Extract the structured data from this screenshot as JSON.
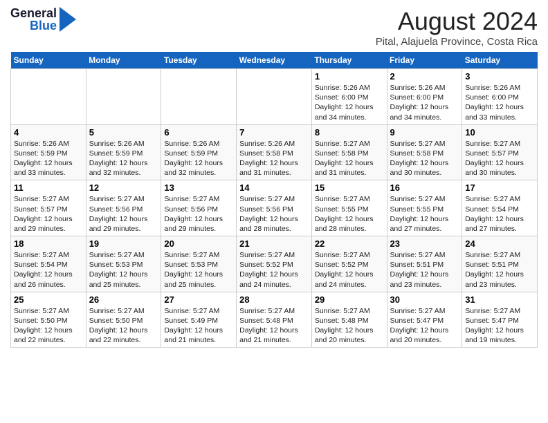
{
  "header": {
    "logo_general": "General",
    "logo_blue": "Blue",
    "title": "August 2024",
    "subtitle": "Pital, Alajuela Province, Costa Rica"
  },
  "weekdays": [
    "Sunday",
    "Monday",
    "Tuesday",
    "Wednesday",
    "Thursday",
    "Friday",
    "Saturday"
  ],
  "weeks": [
    [
      {
        "day": "",
        "info": ""
      },
      {
        "day": "",
        "info": ""
      },
      {
        "day": "",
        "info": ""
      },
      {
        "day": "",
        "info": ""
      },
      {
        "day": "1",
        "info": "Sunrise: 5:26 AM\nSunset: 6:00 PM\nDaylight: 12 hours\nand 34 minutes."
      },
      {
        "day": "2",
        "info": "Sunrise: 5:26 AM\nSunset: 6:00 PM\nDaylight: 12 hours\nand 34 minutes."
      },
      {
        "day": "3",
        "info": "Sunrise: 5:26 AM\nSunset: 6:00 PM\nDaylight: 12 hours\nand 33 minutes."
      }
    ],
    [
      {
        "day": "4",
        "info": "Sunrise: 5:26 AM\nSunset: 5:59 PM\nDaylight: 12 hours\nand 33 minutes."
      },
      {
        "day": "5",
        "info": "Sunrise: 5:26 AM\nSunset: 5:59 PM\nDaylight: 12 hours\nand 32 minutes."
      },
      {
        "day": "6",
        "info": "Sunrise: 5:26 AM\nSunset: 5:59 PM\nDaylight: 12 hours\nand 32 minutes."
      },
      {
        "day": "7",
        "info": "Sunrise: 5:26 AM\nSunset: 5:58 PM\nDaylight: 12 hours\nand 31 minutes."
      },
      {
        "day": "8",
        "info": "Sunrise: 5:27 AM\nSunset: 5:58 PM\nDaylight: 12 hours\nand 31 minutes."
      },
      {
        "day": "9",
        "info": "Sunrise: 5:27 AM\nSunset: 5:58 PM\nDaylight: 12 hours\nand 30 minutes."
      },
      {
        "day": "10",
        "info": "Sunrise: 5:27 AM\nSunset: 5:57 PM\nDaylight: 12 hours\nand 30 minutes."
      }
    ],
    [
      {
        "day": "11",
        "info": "Sunrise: 5:27 AM\nSunset: 5:57 PM\nDaylight: 12 hours\nand 29 minutes."
      },
      {
        "day": "12",
        "info": "Sunrise: 5:27 AM\nSunset: 5:56 PM\nDaylight: 12 hours\nand 29 minutes."
      },
      {
        "day": "13",
        "info": "Sunrise: 5:27 AM\nSunset: 5:56 PM\nDaylight: 12 hours\nand 29 minutes."
      },
      {
        "day": "14",
        "info": "Sunrise: 5:27 AM\nSunset: 5:56 PM\nDaylight: 12 hours\nand 28 minutes."
      },
      {
        "day": "15",
        "info": "Sunrise: 5:27 AM\nSunset: 5:55 PM\nDaylight: 12 hours\nand 28 minutes."
      },
      {
        "day": "16",
        "info": "Sunrise: 5:27 AM\nSunset: 5:55 PM\nDaylight: 12 hours\nand 27 minutes."
      },
      {
        "day": "17",
        "info": "Sunrise: 5:27 AM\nSunset: 5:54 PM\nDaylight: 12 hours\nand 27 minutes."
      }
    ],
    [
      {
        "day": "18",
        "info": "Sunrise: 5:27 AM\nSunset: 5:54 PM\nDaylight: 12 hours\nand 26 minutes."
      },
      {
        "day": "19",
        "info": "Sunrise: 5:27 AM\nSunset: 5:53 PM\nDaylight: 12 hours\nand 25 minutes."
      },
      {
        "day": "20",
        "info": "Sunrise: 5:27 AM\nSunset: 5:53 PM\nDaylight: 12 hours\nand 25 minutes."
      },
      {
        "day": "21",
        "info": "Sunrise: 5:27 AM\nSunset: 5:52 PM\nDaylight: 12 hours\nand 24 minutes."
      },
      {
        "day": "22",
        "info": "Sunrise: 5:27 AM\nSunset: 5:52 PM\nDaylight: 12 hours\nand 24 minutes."
      },
      {
        "day": "23",
        "info": "Sunrise: 5:27 AM\nSunset: 5:51 PM\nDaylight: 12 hours\nand 23 minutes."
      },
      {
        "day": "24",
        "info": "Sunrise: 5:27 AM\nSunset: 5:51 PM\nDaylight: 12 hours\nand 23 minutes."
      }
    ],
    [
      {
        "day": "25",
        "info": "Sunrise: 5:27 AM\nSunset: 5:50 PM\nDaylight: 12 hours\nand 22 minutes."
      },
      {
        "day": "26",
        "info": "Sunrise: 5:27 AM\nSunset: 5:50 PM\nDaylight: 12 hours\nand 22 minutes."
      },
      {
        "day": "27",
        "info": "Sunrise: 5:27 AM\nSunset: 5:49 PM\nDaylight: 12 hours\nand 21 minutes."
      },
      {
        "day": "28",
        "info": "Sunrise: 5:27 AM\nSunset: 5:48 PM\nDaylight: 12 hours\nand 21 minutes."
      },
      {
        "day": "29",
        "info": "Sunrise: 5:27 AM\nSunset: 5:48 PM\nDaylight: 12 hours\nand 20 minutes."
      },
      {
        "day": "30",
        "info": "Sunrise: 5:27 AM\nSunset: 5:47 PM\nDaylight: 12 hours\nand 20 minutes."
      },
      {
        "day": "31",
        "info": "Sunrise: 5:27 AM\nSunset: 5:47 PM\nDaylight: 12 hours\nand 19 minutes."
      }
    ]
  ]
}
